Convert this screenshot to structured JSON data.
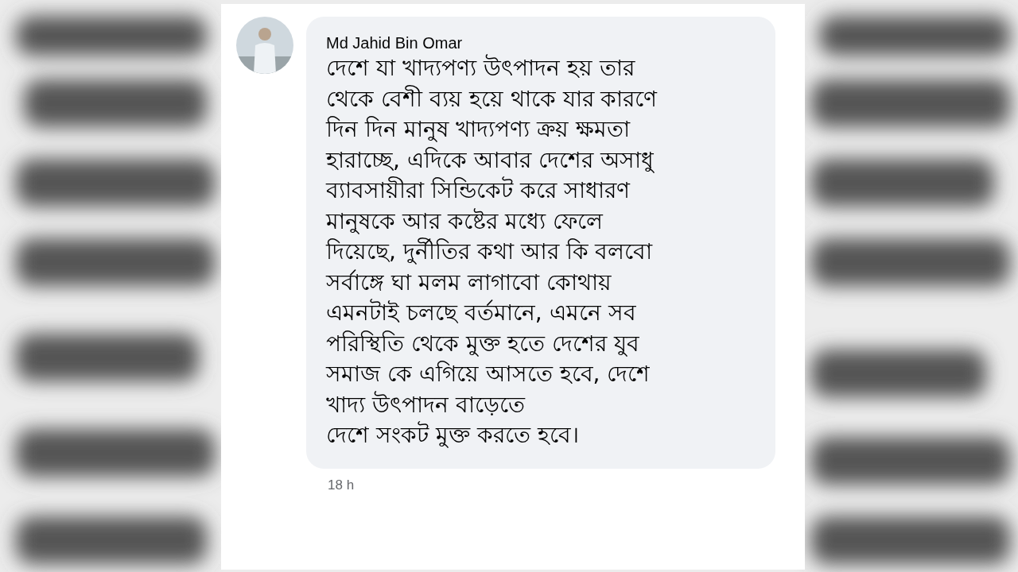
{
  "comment": {
    "author": "Md Jahid Bin Omar",
    "lines": [
      "দেশে যা খাদ্যপণ্য উৎপাদন হয় তার",
      "থেকে বেশী ব্যয় হয়ে থাকে যার কারণে",
      "দিন দিন মানুষ খাদ্যপণ্য ক্রয় ক্ষমতা",
      "হারাচ্ছে, এদিকে আবার দেশের অসাধু",
      "ব্যাবসায়ীরা সিন্ডিকেট করে সাধারণ",
      "মানুষকে আর কষ্টের মধ্যে ফেলে",
      "দিয়েছে, দুর্নীতির কথা আর কি বলবো",
      "সর্বাঙ্গে ঘা মলম লাগাবো কোথায়",
      "এমনটাই চলছে বর্তমানে, এমনে সব",
      "পরিস্থিতি থেকে মুক্ত হতে দেশের যুব",
      "সমাজ কে এগিয়ে আসতে হবে, দেশে",
      "খাদ্য উৎপাদন বাড়েতে",
      "দেশে সংকট মুক্ত করতে হবে।"
    ],
    "time": "18 h"
  }
}
